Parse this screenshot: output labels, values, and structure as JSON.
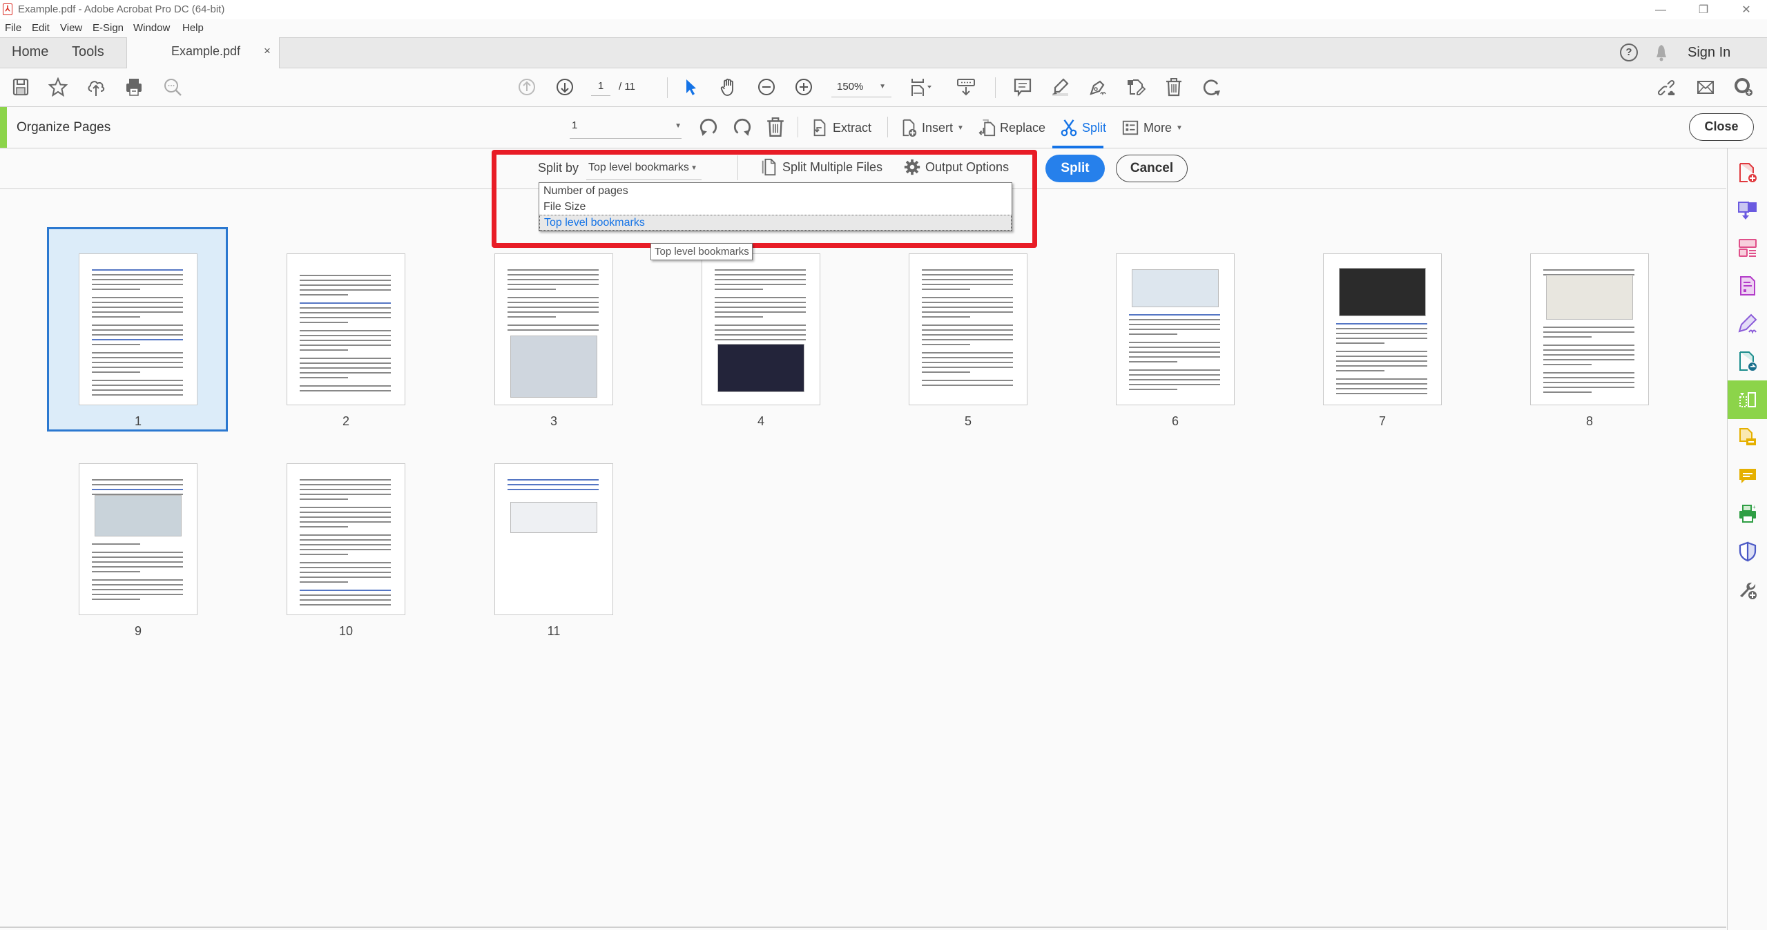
{
  "window": {
    "title": "Example.pdf - Adobe Acrobat Pro DC (64-bit)",
    "controls": [
      "minimize",
      "restore",
      "close"
    ]
  },
  "menu": [
    "File",
    "Edit",
    "View",
    "E-Sign",
    "Window",
    "Help"
  ],
  "tabs": {
    "home": "Home",
    "tools": "Tools",
    "document": "Example.pdf",
    "close_glyph": "×",
    "sign_in": "Sign In"
  },
  "toolbar": {
    "page_current": "1",
    "page_total": "/ 11",
    "zoom": "150%",
    "icons_left": [
      "save-icon",
      "bookmark-star-icon",
      "upload-cloud-icon",
      "print-icon",
      "search-zoom-icon"
    ],
    "icons_center": [
      "prev-page-icon",
      "next-page-icon",
      "select-arrow-icon",
      "hand-icon",
      "zoom-out-icon",
      "zoom-in-icon",
      "fit-page-icon",
      "scroll-mode-icon"
    ],
    "icons_right": [
      "comment-icon",
      "highlight-icon",
      "sign-pen-icon",
      "edit-pdf-icon",
      "delete-icon",
      "redo-icon"
    ],
    "icons_far_right": [
      "share-link-icon",
      "email-icon",
      "add-user-icon"
    ]
  },
  "organize": {
    "title": "Organize Pages",
    "page_select": "1",
    "extract": "Extract",
    "insert": "Insert",
    "replace": "Replace",
    "split": "Split",
    "more": "More",
    "close": "Close"
  },
  "split_bar": {
    "split_by_label": "Split by",
    "split_by_value": "Top level bookmarks",
    "split_multiple": "Split Multiple Files",
    "output_options": "Output Options",
    "split_button": "Split",
    "cancel_button": "Cancel",
    "dropdown_options": [
      "Number of pages",
      "File Size",
      "Top level bookmarks"
    ],
    "dropdown_selected_index": 2,
    "tooltip": "Top level bookmarks"
  },
  "highlight_color": "#e81c26",
  "accent_color": "#1473e6",
  "organize_accent": "#8cd44a",
  "pages": [
    {
      "num": "1",
      "selected": true
    },
    {
      "num": "2",
      "selected": false
    },
    {
      "num": "3",
      "selected": false
    },
    {
      "num": "4",
      "selected": false
    },
    {
      "num": "5",
      "selected": false
    },
    {
      "num": "6",
      "selected": false
    },
    {
      "num": "7",
      "selected": false
    },
    {
      "num": "8",
      "selected": false
    },
    {
      "num": "9",
      "selected": false
    },
    {
      "num": "10",
      "selected": false
    },
    {
      "num": "11",
      "selected": false
    }
  ],
  "right_panel_tools": [
    "create-pdf-icon",
    "export-pdf-icon",
    "organize-forms-icon",
    "edit-form-icon",
    "fill-sign-icon",
    "send-pdf-icon",
    "organize-pages-icon",
    "combine-comment-icon",
    "comment-tool-icon",
    "print-production-icon",
    "protect-icon",
    "more-tools-icon"
  ],
  "right_panel_active_index": 6
}
